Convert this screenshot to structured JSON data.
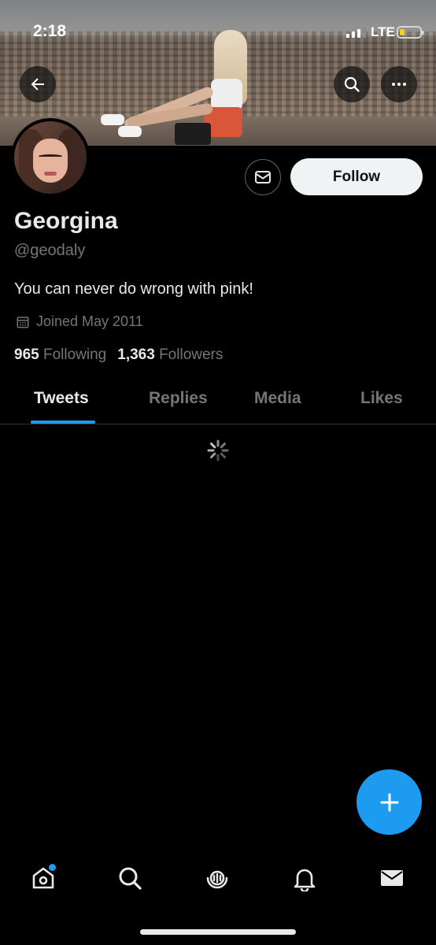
{
  "status_bar": {
    "time": "2:18",
    "network": "LTE",
    "battery_color": "#f4d11e"
  },
  "header": {
    "back_icon": "arrow-left-icon",
    "search_icon": "search-icon",
    "more_icon": "more-horizontal-icon"
  },
  "profile": {
    "name": "Georgina",
    "handle": "@geodaly",
    "bio": "You can never do wrong with pink!",
    "joined": "Joined May 2011",
    "following_count": "965",
    "following_label": "Following",
    "followers_count": "1,363",
    "followers_label": "Followers",
    "follow_button_label": "Follow",
    "message_icon": "envelope-icon"
  },
  "tabs": [
    {
      "label": "Tweets",
      "active": true
    },
    {
      "label": "Replies",
      "active": false
    },
    {
      "label": "Media",
      "active": false
    },
    {
      "label": "Likes",
      "active": false
    }
  ],
  "fab": {
    "icon": "plus-icon",
    "color": "#1d9bf0"
  },
  "bottom_nav": [
    {
      "icon": "home-icon",
      "has_badge": true
    },
    {
      "icon": "search-icon"
    },
    {
      "icon": "spaces-icon"
    },
    {
      "icon": "bell-icon"
    },
    {
      "icon": "envelope-icon"
    }
  ],
  "colors": {
    "accent": "#1d9bf0",
    "background": "#000000",
    "muted_text": "#71767b"
  }
}
